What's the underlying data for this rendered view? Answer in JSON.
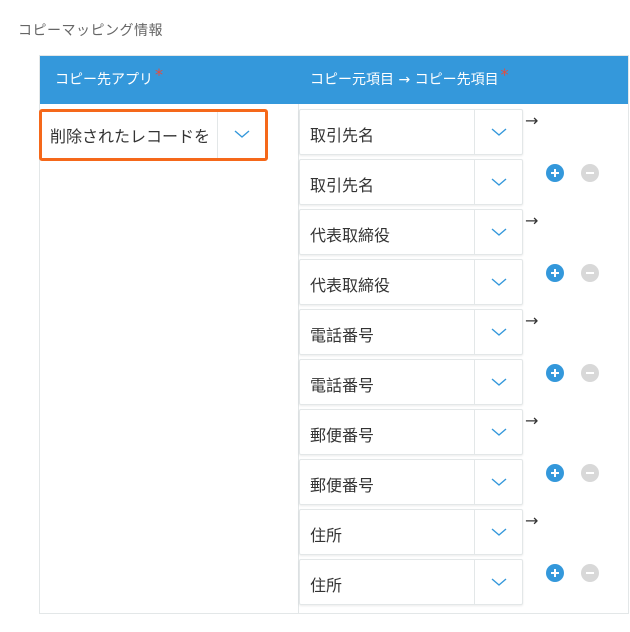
{
  "section_title": "コピーマッピング情報",
  "header": {
    "col_app": "コピー先アプリ",
    "col_fields": "コピー元項目 → コピー先項目",
    "required_mark": "*"
  },
  "app_select": {
    "value": "削除されたレコードを",
    "icon": "chevron-down-icon"
  },
  "arrow_symbol": "→",
  "mappings": [
    {
      "source": "取引先名",
      "target": "取引先名"
    },
    {
      "source": "代表取締役",
      "target": "代表取締役"
    },
    {
      "source": "電話番号",
      "target": "電話番号"
    },
    {
      "source": "郵便番号",
      "target": "郵便番号"
    },
    {
      "source": "住所",
      "target": "住所"
    }
  ],
  "colors": {
    "header_bg": "#3498db",
    "required": "#e74c3c",
    "highlight_border": "#f5681a",
    "add_button": "#3498db",
    "remove_button": "#d8d8d8"
  }
}
